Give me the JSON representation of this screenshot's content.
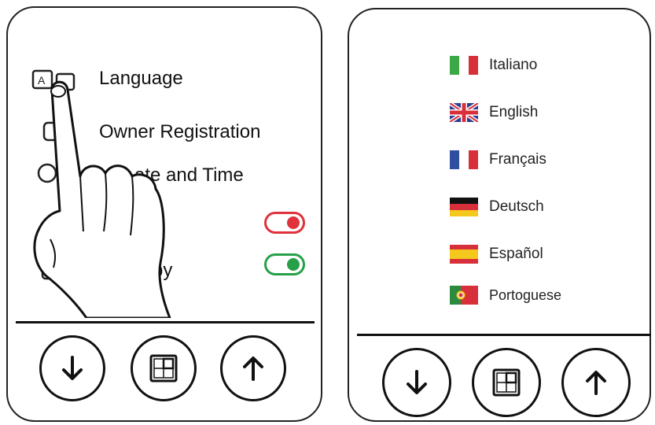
{
  "settings_menu": {
    "items": [
      {
        "label": "Language",
        "icon": "language-icon"
      },
      {
        "label": "Owner Registration",
        "icon": "user-icon"
      },
      {
        "label": "ate and Time",
        "icon": "clock-icon"
      },
      {
        "label": "by",
        "icon": "standby-icon"
      }
    ],
    "toggles": [
      {
        "state": "on",
        "color": "#e0323c"
      },
      {
        "state": "on",
        "color": "#25a048"
      }
    ]
  },
  "language_menu": {
    "items": [
      {
        "label": "Italiano",
        "flag": "italy-flag-icon"
      },
      {
        "label": "English",
        "flag": "uk-flag-icon"
      },
      {
        "label": "Français",
        "flag": "france-flag-icon"
      },
      {
        "label": "Deutsch",
        "flag": "germany-flag-icon"
      },
      {
        "label": "Español",
        "flag": "spain-flag-icon"
      },
      {
        "label": "Portoguese",
        "flag": "portugal-flag-icon"
      }
    ]
  },
  "nav_buttons": [
    "down-arrow-icon",
    "menu-enter-icon",
    "up-arrow-icon"
  ],
  "gesture": "pointing-hand-icon"
}
